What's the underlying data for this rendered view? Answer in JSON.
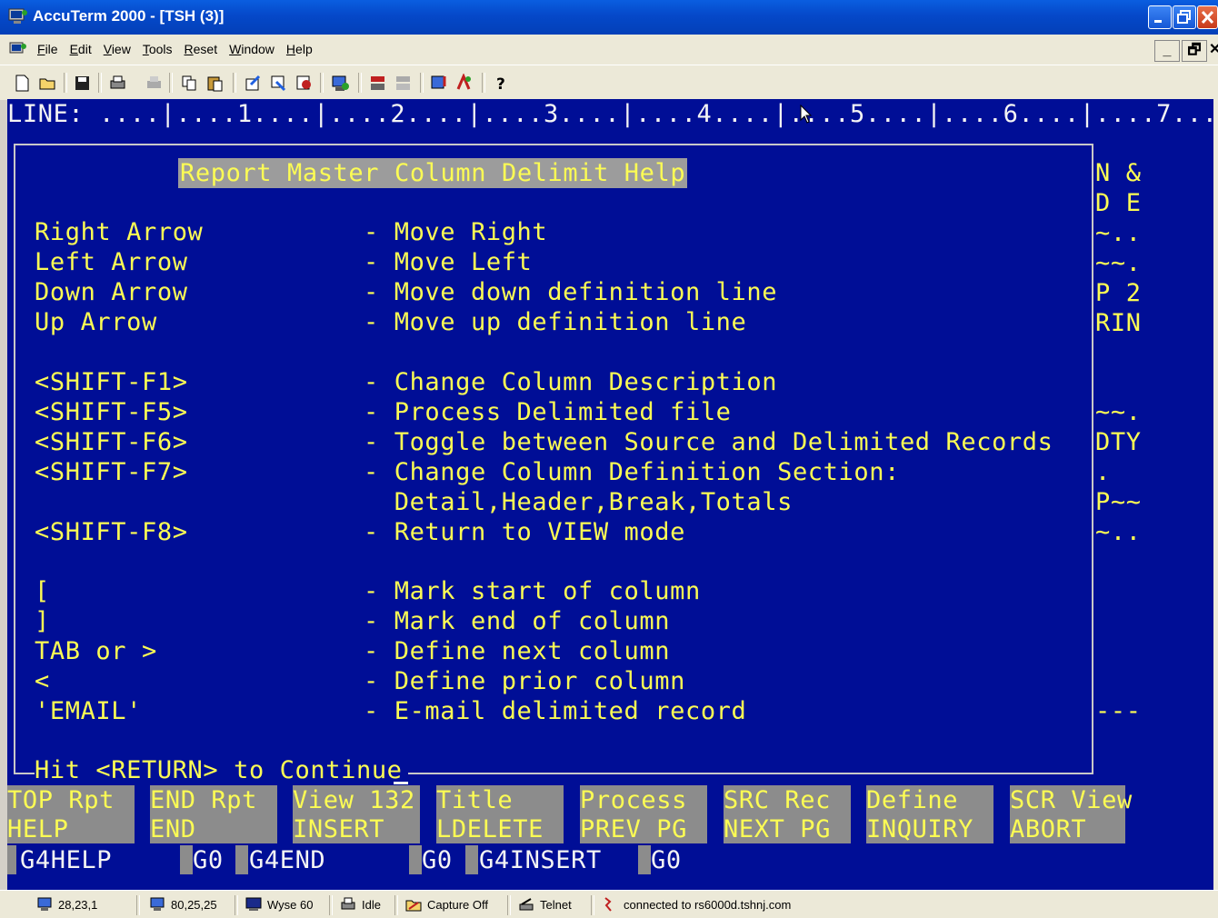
{
  "window": {
    "title": "AccuTerm 2000 - [TSH (3)]"
  },
  "menu": [
    "File",
    "Edit",
    "View",
    "Tools",
    "Reset",
    "Window",
    "Help"
  ],
  "mdi_controls": [
    "_",
    "🗗",
    "✕"
  ],
  "terminal": {
    "ruler": "LINE: ....|....1....|....2....|....3....|....4....|....5....|....6....|....7...",
    "help_title": "Report Master Column Delimit Help",
    "help_rows": [
      {
        "key": "Right Arrow",
        "desc": "- Move Right"
      },
      {
        "key": "Left Arrow",
        "desc": "- Move Left"
      },
      {
        "key": "Down Arrow",
        "desc": "- Move down definition line"
      },
      {
        "key": "Up Arrow",
        "desc": "- Move up definition line"
      },
      {
        "key": "<SHIFT-F1>",
        "desc": "- Change Column Description"
      },
      {
        "key": "<SHIFT-F5>",
        "desc": "- Process Delimited file"
      },
      {
        "key": "<SHIFT-F6>",
        "desc": "- Toggle between Source and Delimited Records"
      },
      {
        "key": "<SHIFT-F7>",
        "desc": "- Change Column Definition Section:"
      },
      {
        "key": "",
        "desc": "  Detail,Header,Break,Totals"
      },
      {
        "key": "<SHIFT-F8>",
        "desc": "- Return to VIEW mode"
      },
      {
        "key": "[",
        "desc": "- Mark start of column"
      },
      {
        "key": "]",
        "desc": "- Mark end of column"
      },
      {
        "key": "TAB or >",
        "desc": "- Define next column"
      },
      {
        "key": "<",
        "desc": "- Define prior column"
      },
      {
        "key": "'EMAIL'",
        "desc": "- E-mail delimited record"
      }
    ],
    "right_column": [
      "N &",
      "D E",
      "~..",
      "~~.",
      "P 2",
      "RIN",
      "~~.",
      "DTY",
      ".",
      "P~~",
      "~..",
      "---"
    ],
    "continue_prompt": "Hit <RETURN> to Continue",
    "fkeys": [
      {
        "line1": "TOP Rpt",
        "line2": "HELP"
      },
      {
        "line1": "END Rpt",
        "line2": "END"
      },
      {
        "line1": "View 132",
        "line2": "INSERT"
      },
      {
        "line1": "Title",
        "line2": "LDELETE"
      },
      {
        "line1": "Process",
        "line2": "PREV PG"
      },
      {
        "line1": "SRC Rec",
        "line2": "NEXT PG"
      },
      {
        "line1": "Define",
        "line2": "INQUIRY"
      },
      {
        "line1": "SCR View",
        "line2": "ABORT"
      }
    ],
    "bottom_line": [
      "G4HELP",
      "G0",
      "G4END",
      "G0",
      "G4INSERT",
      "G0"
    ]
  },
  "statusbar": {
    "cursor_pos": "28,23,1",
    "screen_size": "80,25,25",
    "emulation": "Wyse 60",
    "state": "Idle",
    "capture": "Capture Off",
    "protocol": "Telnet",
    "connection": "connected to rs6000d.tshnj.com"
  },
  "colors": {
    "terminal_bg": "#000e96",
    "terminal_yellow": "#fcfc54",
    "function_key_bg": "#8c8c8c",
    "titlebar_blue": "#0548c9"
  }
}
